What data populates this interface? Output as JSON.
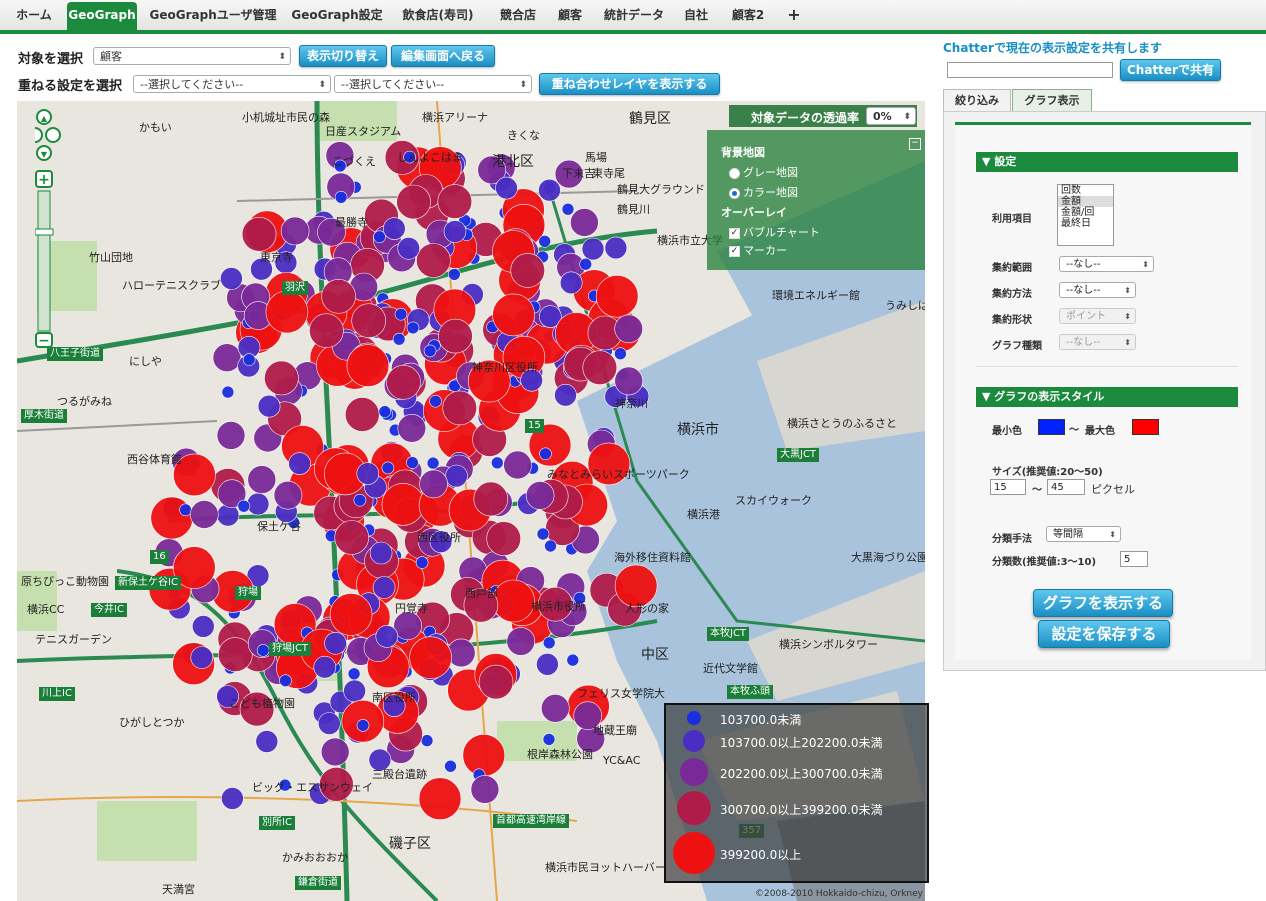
{
  "tabs": [
    {
      "label": "ホーム",
      "active": false
    },
    {
      "label": "GeoGraph",
      "active": true
    },
    {
      "label": "GeoGraphユーザ管理",
      "active": false
    },
    {
      "label": "GeoGraph設定",
      "active": false
    },
    {
      "label": "飲食店(寿司)",
      "active": false
    },
    {
      "label": "競合店",
      "active": false
    },
    {
      "label": "顧客",
      "active": false
    },
    {
      "label": "統計データ",
      "active": false
    },
    {
      "label": "自社",
      "active": false
    },
    {
      "label": "顧客2",
      "active": false
    },
    {
      "label": "+",
      "active": false
    }
  ],
  "controls": {
    "target_label": "対象を選択",
    "target_value": "顧客",
    "toggle_button": "表示切り替え",
    "edit_button": "編集画面へ戻る",
    "overlay_label": "重ねる設定を選択",
    "overlay_select1": "--選択してください--",
    "overlay_select2": "--選択してください--",
    "overlay_button": "重ね合わせレイヤを表示する"
  },
  "map": {
    "opacity_label": "対象データの透過率",
    "opacity_value": "0%",
    "bg_title": "背景地図",
    "gray_map": "グレー地図",
    "color_map": "カラー地図",
    "overlay_title": "オーバーレイ",
    "bubble_chart": "バブルチャート",
    "marker": "マーカー",
    "copyright": "©2008-2010 Hokkaido-chizu, Orkney",
    "places": [
      "小机城址市民の森",
      "日産スタジアム",
      "横浜アリーナ",
      "きくな",
      "鶴見区",
      "かもい",
      "こづくえ",
      "しんよこはま",
      "港北区",
      "馬場",
      "下末吉",
      "最勝寺",
      "竹山団地",
      "東京寺",
      "ハローテニスクラブ",
      "東寺尾",
      "鶴見大グラウンド",
      "横浜市立大学",
      "鶴見川",
      "環境エネルギー館",
      "うみしば",
      "にしや",
      "つるがみね",
      "神奈川",
      "横浜市",
      "横浜さとうのふるさと",
      "西谷体育館",
      "神奈川区役所",
      "みなとみらいスポーツパーク",
      "スカイウォーク",
      "横浜港",
      "保土ケ谷",
      "海外移住資料館",
      "西区役所",
      "横浜市役所",
      "人形の家",
      "中区",
      "近代文学館",
      "大黒海づり公園",
      "原ちびっこ動物園",
      "横浜CC",
      "テニスガーデン",
      "こども植物園",
      "南区役所",
      "ひがしとつか",
      "ビッグ・エスサンウェイ",
      "三殿台遺跡",
      "地蔵王廟",
      "YC&AC",
      "磯子区",
      "かみおおおか",
      "天満宮",
      "横浜市民ヨットハーバー",
      "横浜シンボルタワー",
      "根岸森林公園",
      "根岸",
      "円覚寺",
      "西戸部",
      "フェリス女学院大"
    ],
    "signs": [
      "羽沢",
      "狩場JCT",
      "新保土ケ谷IC",
      "今井IC",
      "狩場",
      "川上IC",
      "別所IC",
      "本牧JCT",
      "本牧ふ頭",
      "大黒JCT",
      "首都高速湾岸線",
      "鎌倉街道",
      "厚木街道",
      "八王子街道",
      "16",
      "15",
      "357"
    ]
  },
  "legend": {
    "items": [
      {
        "label": "103700.0未満",
        "color": "#1a2ee0"
      },
      {
        "label": "103700.0以上202200.0未満",
        "color": "#4a2ec4"
      },
      {
        "label": "202200.0以上300700.0未満",
        "color": "#7a2a98"
      },
      {
        "label": "300700.0以上399200.0未満",
        "color": "#b01c4a"
      },
      {
        "label": "399200.0以上",
        "color": "#ee1111"
      }
    ]
  },
  "chatter": {
    "title": "Chatterで現在の表示設定を共有します",
    "input_value": "",
    "share_button": "Chatterで共有"
  },
  "subtabs": [
    "絞り込み",
    "グラフ表示"
  ],
  "settings": {
    "section_title": "設定",
    "usage_label": "利用項目",
    "usage_options": [
      "回数",
      "金額",
      "金額/回",
      "最終日"
    ],
    "usage_selected": "金額",
    "range_label": "集約範囲",
    "range_value": "--なし--",
    "method_label": "集約方法",
    "method_value": "--なし--",
    "shape_label": "集約形状",
    "shape_value": "ポイント",
    "type_label": "グラフ種類",
    "type_value": "--なし--"
  },
  "style": {
    "section_title": "グラフの表示スタイル",
    "min_color_label": "最小色",
    "max_color_label": "最大色",
    "tilde": "〜",
    "min_color": "#0022ff",
    "max_color": "#ff0000",
    "size_label": "サイズ(推奨値:20〜50)",
    "size_min": "15",
    "size_max": "45",
    "size_unit": "ピクセル",
    "class_method_label": "分類手法",
    "class_method_value": "等間隔",
    "class_count_label": "分類数(推奨値:3〜10)",
    "class_count_value": "5"
  },
  "actions": {
    "show_graph": "グラフを表示する",
    "save_settings": "設定を保存する"
  }
}
